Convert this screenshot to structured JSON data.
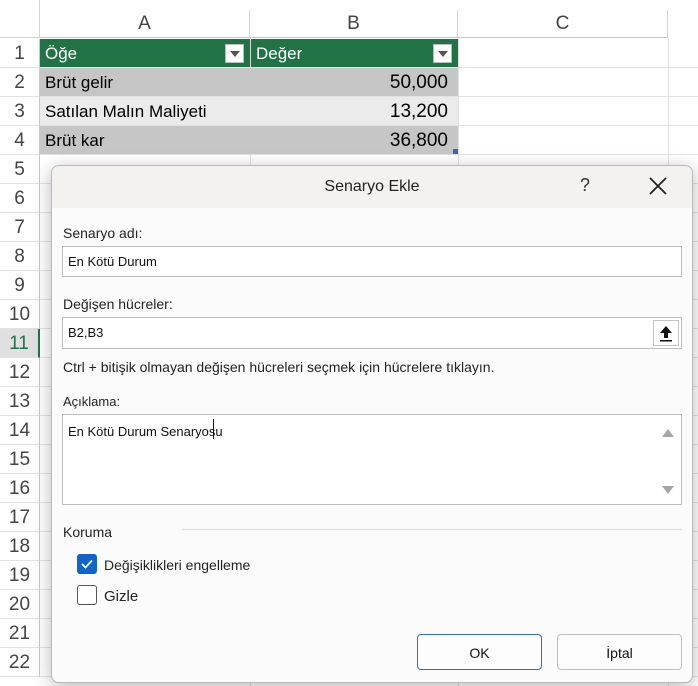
{
  "columns": [
    "A",
    "B",
    "C"
  ],
  "rows": [
    "1",
    "2",
    "3",
    "4",
    "5",
    "6",
    "7",
    "8",
    "9",
    "10",
    "11",
    "12",
    "13",
    "14",
    "15",
    "16",
    "17",
    "18",
    "19",
    "20",
    "21",
    "22"
  ],
  "selected_row": "11",
  "table": {
    "headers": [
      "Öğe",
      "Değer"
    ],
    "rows": [
      {
        "item": "Brüt gelir",
        "value": "50,000"
      },
      {
        "item": "Satılan Malın Maliyeti",
        "value": "13,200"
      },
      {
        "item": "Brüt kar",
        "value": "36,800"
      }
    ]
  },
  "colors": {
    "header_green": "#217346",
    "row_dark": "#c6c6c6",
    "row_light": "#ebebeb",
    "accent_blue": "#0f63c9"
  },
  "dialog": {
    "title": "Senaryo Ekle",
    "help": "?",
    "scenario_name_label": "Senaryo adı:",
    "scenario_name_value": "En Kötü Durum",
    "changing_cells_label": "Değişen hücreler:",
    "changing_cells_value": "B2,B3",
    "hint": "Ctrl + bitişik olmayan değişen hücreleri seçmek için hücrelere tıklayın.",
    "comment_label": "Açıklama:",
    "comment_value": "En Kötü Durum Senaryosu",
    "protection_label": "Koruma",
    "prevent_changes_label": "Değişiklikleri engelleme",
    "prevent_changes_checked": true,
    "hide_label": "Gizle",
    "hide_checked": false,
    "ok_label": "OK",
    "cancel_label": "İptal"
  }
}
